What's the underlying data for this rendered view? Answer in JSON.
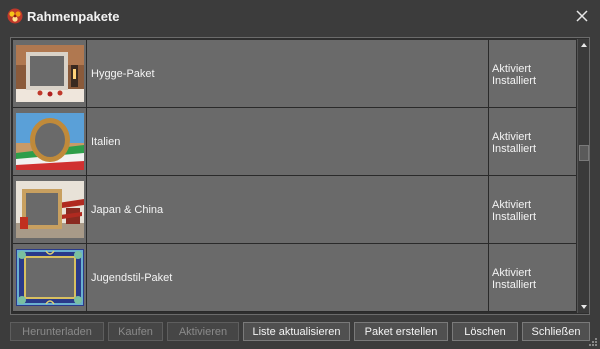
{
  "window": {
    "title": "Rahmenpakete",
    "icon": "app-logo-icon",
    "close_icon": "close-icon"
  },
  "packages": [
    {
      "name": "Hygge-Paket",
      "status": [
        "Aktiviert",
        "Installiert"
      ],
      "thumbnail": "hygge-frame-thumbnail"
    },
    {
      "name": "Italien",
      "status": [
        "Aktiviert",
        "Installiert"
      ],
      "thumbnail": "italy-frame-thumbnail"
    },
    {
      "name": "Japan & China",
      "status": [
        "Aktiviert",
        "Installiert"
      ],
      "thumbnail": "asia-frame-thumbnail"
    },
    {
      "name": "Jugendstil-Paket",
      "status": [
        "Aktiviert",
        "Installiert"
      ],
      "thumbnail": "art-nouveau-frame-thumbnail"
    }
  ],
  "buttons": {
    "download": "Herunterladen",
    "buy": "Kaufen",
    "activate": "Aktivieren",
    "refresh": "Liste aktualisieren",
    "create": "Paket erstellen",
    "delete": "Löschen",
    "close": "Schließen"
  },
  "colors": {
    "window_bg": "#3c3c3c",
    "row_bg": "#6a6a6a",
    "text": "#f4f4f4",
    "disabled_text": "#8a8a8a"
  }
}
